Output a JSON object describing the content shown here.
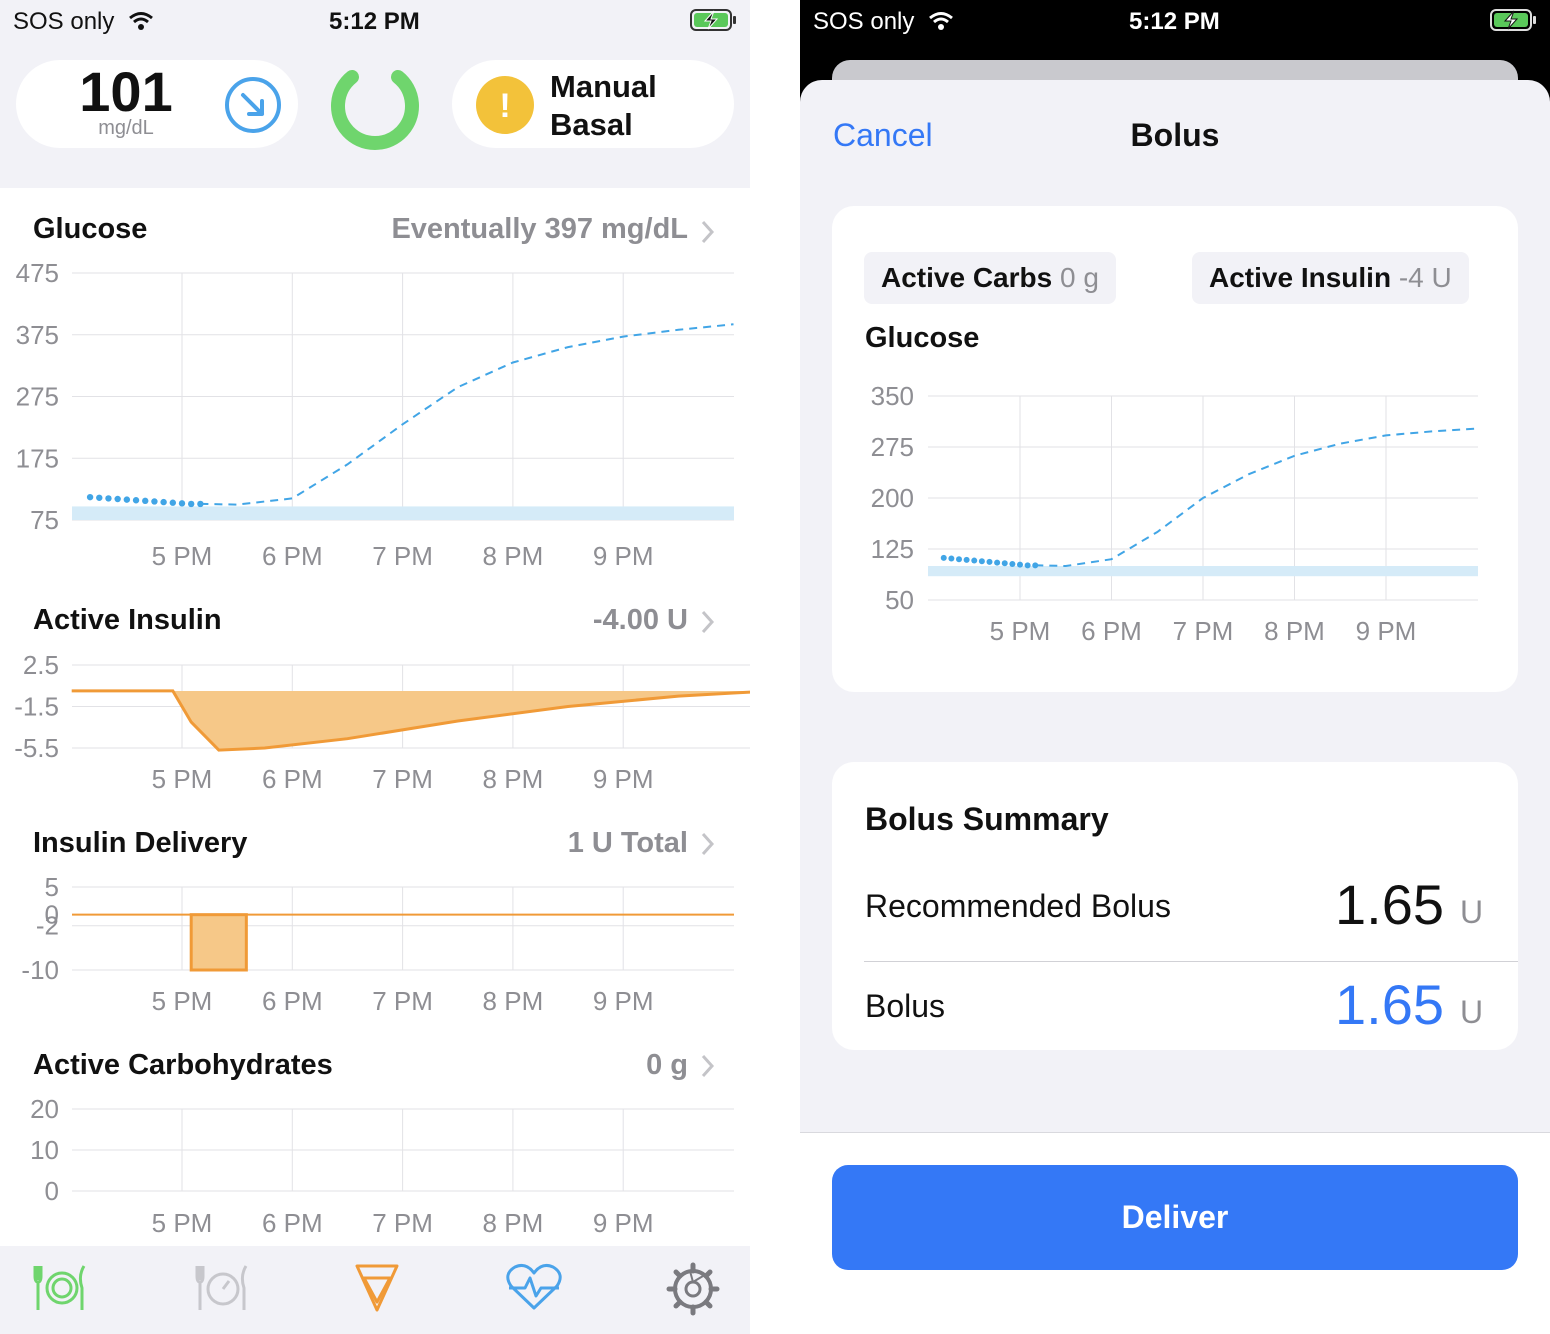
{
  "status": {
    "carrier": "SOS only",
    "time": "5:12 PM"
  },
  "hud": {
    "glucose_value": "101",
    "glucose_unit": "mg/dL",
    "mode_label_1": "Manual",
    "mode_label_2": "Basal",
    "alert_glyph": "!"
  },
  "sections": {
    "glucose": {
      "title": "Glucose",
      "value": "Eventually 397 mg/dL",
      "y_ticks": [
        "475",
        "375",
        "275",
        "175",
        "75"
      ]
    },
    "insulin": {
      "title": "Active Insulin",
      "value": "-4.00 U",
      "y_ticks": [
        "2.5",
        "-1.5",
        "-5.5"
      ]
    },
    "delivery": {
      "title": "Insulin Delivery",
      "value": "1 U Total",
      "y_ticks": [
        "5",
        "0",
        "-2",
        "-10"
      ]
    },
    "carbs": {
      "title": "Active Carbohydrates",
      "value": "0 g",
      "y_ticks": [
        "20",
        "10",
        "0"
      ]
    }
  },
  "time_ticks": [
    "5 PM",
    "6 PM",
    "7 PM",
    "8 PM",
    "9 PM"
  ],
  "tabs": [
    "carbs-icon",
    "pre-meal-icon",
    "bolus-icon",
    "workout-icon",
    "settings-icon"
  ],
  "bolus_sheet": {
    "cancel": "Cancel",
    "title": "Bolus",
    "active_carbs_label": "Active Carbs",
    "active_carbs_value": "0 g",
    "active_insulin_label": "Active Insulin",
    "active_insulin_value": "-4 U",
    "glucose_title": "Glucose",
    "y_ticks": [
      "350",
      "275",
      "200",
      "125",
      "50"
    ],
    "summary_title": "Bolus Summary",
    "recommended_label": "Recommended Bolus",
    "recommended_value": "1.65",
    "bolus_label": "Bolus",
    "bolus_value": "1.65",
    "unit": "U",
    "deliver": "Deliver"
  },
  "colors": {
    "accent_blue": "#3478f6",
    "glucose_blue": "#41a5e6",
    "insulin_orange": "#f09a37",
    "range_band": "#d5ebf8",
    "green": "#6fd56d",
    "alert_yellow": "#f3c23a"
  },
  "chart_data": [
    {
      "type": "line",
      "title": "Glucose",
      "x_ticks": [
        "5 PM",
        "6 PM",
        "7 PM",
        "8 PM",
        "9 PM"
      ],
      "ylim": [
        75,
        475
      ],
      "target_range": [
        75,
        97
      ],
      "series": [
        {
          "style": "dots",
          "x": [
            "4:10",
            "4:15",
            "4:20",
            "4:25",
            "4:30",
            "4:35",
            "4:40",
            "4:45",
            "4:50",
            "4:55",
            "5:00",
            "5:05",
            "5:10"
          ],
          "y": [
            112,
            111,
            110,
            109,
            108,
            107,
            106,
            105,
            104,
            103,
            102,
            101,
            101
          ]
        },
        {
          "style": "dashed",
          "x": [
            "5:10",
            "5:30",
            "6:00",
            "6:30",
            "7:00",
            "7:30",
            "8:00",
            "8:30",
            "9:00",
            "9:30",
            "10:00"
          ],
          "y": [
            101,
            100,
            110,
            165,
            230,
            290,
            330,
            355,
            372,
            383,
            392
          ]
        }
      ]
    },
    {
      "type": "area",
      "title": "Active Insulin",
      "x_ticks": [
        "5 PM",
        "6 PM",
        "7 PM",
        "8 PM",
        "9 PM"
      ],
      "ylim": [
        -5.5,
        2.5
      ],
      "x": [
        "4:00",
        "4:55",
        "5:05",
        "5:20",
        "5:45",
        "6:30",
        "7:30",
        "8:30",
        "9:30",
        "10:00",
        "10:10"
      ],
      "values": [
        0,
        0,
        -3,
        -5.7,
        -5.5,
        -4.6,
        -2.9,
        -1.5,
        -0.5,
        -0.2,
        -0.1
      ]
    },
    {
      "type": "bar",
      "title": "Insulin Delivery",
      "x_ticks": [
        "5 PM",
        "6 PM",
        "7 PM",
        "8 PM",
        "9 PM"
      ],
      "ylim": [
        -10,
        5
      ],
      "x": [
        "4:00",
        "5:05",
        "5:35",
        "10:00"
      ],
      "values": [
        0,
        -10,
        0,
        0
      ]
    },
    {
      "type": "line",
      "title": "Active Carbohydrates",
      "x_ticks": [
        "5 PM",
        "6 PM",
        "7 PM",
        "8 PM",
        "9 PM"
      ],
      "ylim": [
        0,
        20
      ],
      "x": [],
      "values": []
    },
    {
      "type": "line",
      "title": "Glucose",
      "x_ticks": [
        "5 PM",
        "6 PM",
        "7 PM",
        "8 PM",
        "9 PM"
      ],
      "ylim": [
        50,
        350
      ],
      "target_range": [
        85,
        100
      ],
      "series": [
        {
          "style": "dots",
          "x": [
            "4:10",
            "4:15",
            "4:20",
            "4:25",
            "4:30",
            "4:35",
            "4:40",
            "4:45",
            "4:50",
            "4:55",
            "5:00",
            "5:05",
            "5:10"
          ],
          "y": [
            112,
            111,
            110,
            109,
            108,
            107,
            106,
            105,
            104,
            103,
            102,
            101,
            101
          ]
        },
        {
          "style": "dashed",
          "x": [
            "5:10",
            "5:30",
            "6:00",
            "6:30",
            "7:00",
            "7:30",
            "8:00",
            "8:30",
            "9:00",
            "9:30",
            "10:00"
          ],
          "y": [
            101,
            100,
            110,
            150,
            200,
            235,
            262,
            280,
            292,
            298,
            302
          ]
        }
      ]
    }
  ]
}
